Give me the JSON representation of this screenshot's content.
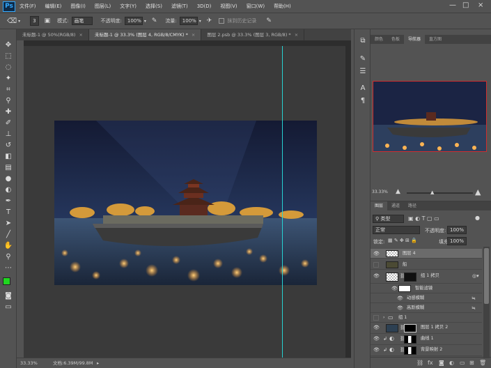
{
  "app": {
    "logo": "Ps"
  },
  "menu": [
    "文件(F)",
    "编辑(E)",
    "图像(I)",
    "图层(L)",
    "文字(Y)",
    "选择(S)",
    "滤镜(T)",
    "3D(D)",
    "视图(V)",
    "窗口(W)",
    "帮助(H)"
  ],
  "window_controls": {
    "minimize": "—",
    "maximize": "□",
    "close": "×"
  },
  "options": {
    "brush_size": "3",
    "mode_label": "模式:",
    "mode_value": "画笔",
    "opacity_label": "不透明度:",
    "opacity_value": "100%",
    "flow_label": "流量:",
    "flow_value": "100%",
    "history_label": "抹到历史记录"
  },
  "tabs": [
    {
      "label": "未标题-1 @ 50%(RGB/8)",
      "active": false
    },
    {
      "label": "未标题-1 @ 33.3% (图层 4, RGB/8/CMYK) *",
      "active": true
    },
    {
      "label": "图层 2.psb @ 33.3% (图层 3, RGB/8) *",
      "active": false
    }
  ],
  "status": {
    "zoom": "33.33%",
    "doc": "文档:6.39M/99.8M"
  },
  "panel_top_tabs": [
    {
      "label": "颜色",
      "active": false
    },
    {
      "label": "色板",
      "active": false
    },
    {
      "label": "导航器",
      "active": true
    },
    {
      "label": "直方图",
      "active": false
    }
  ],
  "navigator": {
    "zoom": "33.33%"
  },
  "layer_tabs": [
    {
      "label": "图层",
      "active": true
    },
    {
      "label": "通道",
      "active": false
    },
    {
      "label": "路径",
      "active": false
    }
  ],
  "layers_panel": {
    "filter_kind": "类型",
    "blend_mode": "正常",
    "opacity_label": "不透明度:",
    "opacity_value": "100%",
    "lock_label": "锁定:",
    "fill_label": "填充:",
    "fill_value": "100%"
  },
  "layers": [
    {
      "name": "图层 4",
      "visible": true,
      "selected": true
    },
    {
      "name": "船",
      "visible": false,
      "selected": false
    },
    {
      "name": "组 1 拷贝",
      "visible": true,
      "selected": false
    },
    {
      "name": "智能滤镜",
      "visible": true,
      "selected": false
    },
    {
      "name": "动感模糊",
      "visible": true,
      "selected": false
    },
    {
      "name": "高斯模糊",
      "visible": true,
      "selected": false
    },
    {
      "name": "组 1",
      "visible": false,
      "selected": false
    },
    {
      "name": "图层 1 拷贝 2",
      "visible": true,
      "selected": false
    },
    {
      "name": "曲线 1",
      "visible": true,
      "selected": false
    },
    {
      "name": "背景映射 2",
      "visible": true,
      "selected": false
    }
  ],
  "colors": {
    "foreground": "#1fd61f",
    "background": "#ffffff",
    "accent_guide": "#27d3d3",
    "navigator_border": "#d12d2d"
  }
}
